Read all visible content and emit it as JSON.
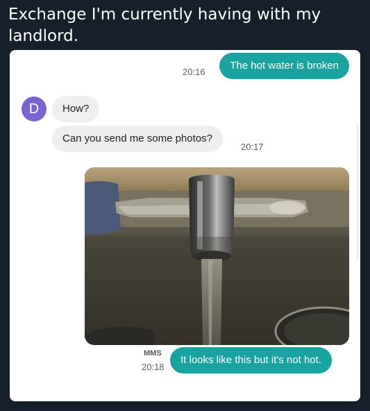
{
  "post": {
    "title": "Exchange I'm currently having with my landlord."
  },
  "conversation": {
    "contact_initial": "D",
    "messages": [
      {
        "direction": "outgoing",
        "text": "The hot water is broken",
        "time": "20:16"
      },
      {
        "direction": "incoming",
        "text": "How?",
        "time": ""
      },
      {
        "direction": "incoming",
        "text": "Can you send me some photos?",
        "time": "20:17"
      },
      {
        "direction": "outgoing",
        "type": "photo",
        "label": "MMS",
        "time": ""
      },
      {
        "direction": "outgoing",
        "text": "It looks like this but it's not hot.",
        "time": "20:18"
      }
    ]
  },
  "colors": {
    "background": "#15202b",
    "card": "#ffffff",
    "outgoing_bubble": "#1aa4a1",
    "incoming_bubble": "#eeeeee",
    "avatar": "#7b63d4"
  }
}
